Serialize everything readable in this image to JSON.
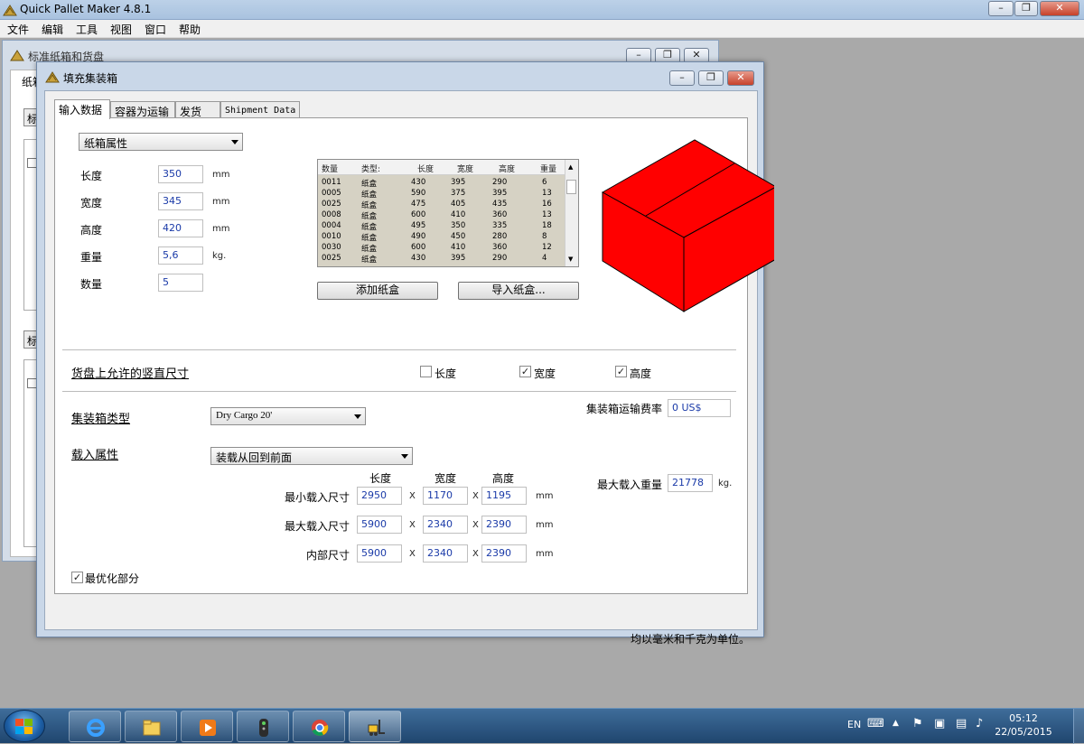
{
  "app": {
    "title": "Quick Pallet Maker 4.8.1"
  },
  "menu": [
    "文件",
    "编辑",
    "工具",
    "视图",
    "窗口",
    "帮助"
  ],
  "bg_window": {
    "title": "标准纸箱和货盘",
    "tab_fragment": "纸箱",
    "button_fragment": "标",
    "button_fragment2": "标"
  },
  "dialog": {
    "title": "填充集装箱",
    "tabs": [
      "输入数据",
      "容器为运输",
      "发货",
      "Shipment Data"
    ],
    "carton_combo": "纸箱属性",
    "fields": [
      {
        "label": "长度",
        "value": "350",
        "unit": "mm"
      },
      {
        "label": "宽度",
        "value": "345",
        "unit": "mm"
      },
      {
        "label": "高度",
        "value": "420",
        "unit": "mm"
      },
      {
        "label": "重量",
        "value": "5,6",
        "unit": "kg."
      },
      {
        "label": "数量",
        "value": "5",
        "unit": ""
      }
    ],
    "list": {
      "headers": [
        "数量",
        "类型:",
        "长度",
        "宽度",
        "高度",
        "重量"
      ],
      "rows": [
        [
          "0011",
          "纸盒",
          "430",
          "395",
          "290",
          "6"
        ],
        [
          "0005",
          "纸盒",
          "590",
          "375",
          "395",
          "13"
        ],
        [
          "0025",
          "纸盒",
          "475",
          "405",
          "435",
          "16"
        ],
        [
          "0008",
          "纸盒",
          "600",
          "410",
          "360",
          "13"
        ],
        [
          "0004",
          "纸盒",
          "495",
          "350",
          "335",
          "18"
        ],
        [
          "0010",
          "纸盒",
          "490",
          "450",
          "280",
          "8"
        ],
        [
          "0030",
          "纸盒",
          "600",
          "410",
          "360",
          "12"
        ],
        [
          "0025",
          "纸盒",
          "430",
          "395",
          "290",
          "4"
        ]
      ]
    },
    "add_button": "添加纸盒",
    "import_button": "导入纸盒...",
    "box_color": "#ff0000",
    "vertical_section": "货盘上允许的竖直尺寸",
    "vertical_checks": [
      {
        "label": "长度",
        "checked": false
      },
      {
        "label": "宽度",
        "checked": true
      },
      {
        "label": "高度",
        "checked": true
      }
    ],
    "container_type_label": "集装箱类型",
    "container_type_value": "Dry Cargo 20'",
    "freight_label": "集装箱运输费率",
    "freight_value": "0 US$",
    "load_attr_label": "载入属性",
    "load_attr_value": "装载从回到前面",
    "dim_headers": [
      "长度",
      "宽度",
      "高度"
    ],
    "dims": [
      {
        "label": "最小载入尺寸",
        "values": [
          "2950",
          "1170",
          "1195"
        ],
        "unit": "mm"
      },
      {
        "label": "最大载入尺寸",
        "values": [
          "5900",
          "2340",
          "2390"
        ],
        "unit": "mm"
      },
      {
        "label": "内部尺寸",
        "values": [
          "5900",
          "2340",
          "2390"
        ],
        "unit": "mm"
      }
    ],
    "dim_sep": "X",
    "max_weight_label": "最大载入重量",
    "max_weight_value": "21778",
    "max_weight_unit": "kg.",
    "optimize_label": "最优化部分",
    "optimize_checked": true,
    "note": "均以毫米和千克为单位。"
  },
  "taskbar": {
    "apps": [
      "ie-icon",
      "explorer-icon",
      "media-player-icon",
      "remote-icon",
      "chrome-icon",
      "forklift-app-icon"
    ],
    "lang": "EN",
    "time": "05:12",
    "date": "22/05/2015"
  }
}
